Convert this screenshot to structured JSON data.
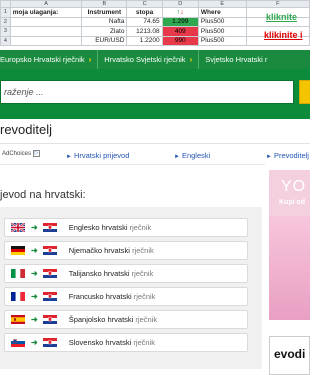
{
  "ad_sheet": {
    "column_letters": [
      "A",
      "B",
      "C",
      "D",
      "E",
      "F"
    ],
    "row_numbers": [
      "1",
      "2",
      "3",
      "4"
    ],
    "header_row": [
      "moja ulaganja:",
      "Instrument",
      "stopa",
      "",
      "Where"
    ],
    "rows": [
      {
        "instrument": "Nafta",
        "stopa": "74.65",
        "value": "1.299",
        "where": "Plus500",
        "state": "green"
      },
      {
        "instrument": "Zlato",
        "stopa": "1213.08",
        "value": "409",
        "where": "Plus500",
        "state": "red"
      },
      {
        "instrument": "EUR/USD",
        "stopa": "1.2200",
        "value": "990",
        "where": "Plus500",
        "state": "red"
      }
    ],
    "link1": "kliknite",
    "link2": "klikinite i",
    "colors": {
      "green": "#2fa84f",
      "red": "#e8394a"
    }
  },
  "nav": {
    "items": [
      {
        "label": "Europsko Hrvatski rječnik"
      },
      {
        "label": "Hrvatsko Svjetski rječnik"
      },
      {
        "label": "Svjetsko Hrvatski r"
      }
    ],
    "accent": "#1a8a3f"
  },
  "search": {
    "placeholder": "raženje ..."
  },
  "page_title": "revoditelj",
  "ads": {
    "adchoices": "AdChoices",
    "links": [
      "Hrvatski prijevod",
      "Engleski",
      "Prevoditelj"
    ]
  },
  "subtitle": "jevod na hrvatski:",
  "dictionaries": [
    {
      "flag": "uk-flag-icon",
      "name": "Englesko hrvatski",
      "suffix": "rječnik"
    },
    {
      "flag": "german-flag-icon",
      "name": "Njemačko hrvatski",
      "suffix": "rječnik"
    },
    {
      "flag": "italian-flag-icon",
      "name": "Talijansko hrvatski",
      "suffix": "rječnik"
    },
    {
      "flag": "french-flag-icon",
      "name": "Francusko hrvatski",
      "suffix": "rječnik"
    },
    {
      "flag": "spanish-flag-icon",
      "name": "Španjolsko hrvatski",
      "suffix": "rječnik"
    },
    {
      "flag": "slovenian-flag-icon",
      "name": "Slovensko hrvatski",
      "suffix": "rječnik"
    }
  ],
  "side_ad": {
    "big_text": "YO",
    "sub_text": "Kupi od",
    "bottom_text": "evodi"
  }
}
